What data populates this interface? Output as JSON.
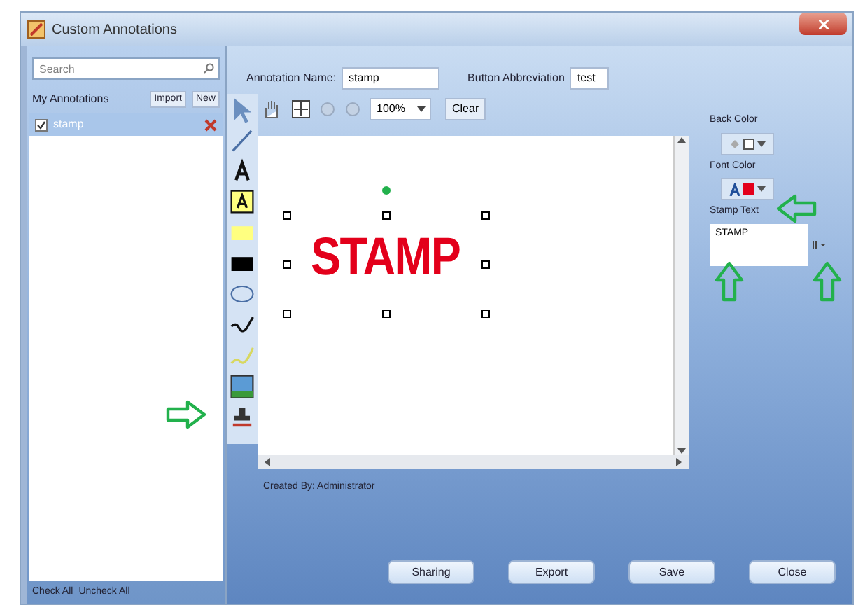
{
  "window": {
    "title": "Custom Annotations"
  },
  "sidebar": {
    "search": {
      "placeholder": "Search"
    },
    "heading": "My Annotations",
    "buttons": [
      "Import",
      "New"
    ],
    "items": [
      {
        "label": "stamp",
        "checked": true,
        "selected": true
      }
    ],
    "footer": [
      "Check All",
      "Uncheck All"
    ]
  },
  "form": {
    "name_label": "Annotation Name:",
    "name_value": "stamp",
    "abbr_label": "Button Abbreviation",
    "abbr_value": "test"
  },
  "toolbar": {
    "zoom": "100%",
    "clear": "Clear"
  },
  "canvas": {
    "stamp_text": "STAMP",
    "selected": true
  },
  "created_by": "Created By: Administrator",
  "properties": {
    "back_color_label": "Back Color",
    "font_color_label": "Font Color",
    "stamp_text_label": "Stamp Text",
    "stamp_text_value": "STAMP"
  },
  "buttons": [
    "Sharing",
    "Export",
    "Save",
    "Close"
  ]
}
